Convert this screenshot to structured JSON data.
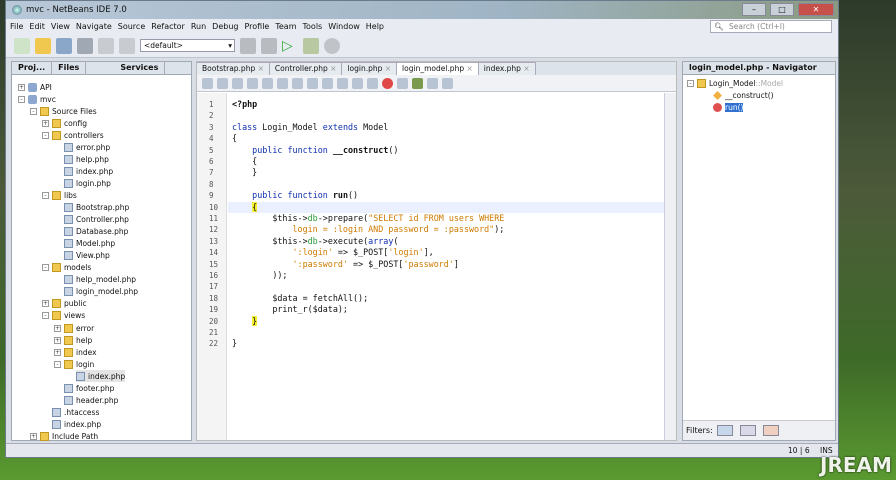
{
  "window": {
    "title": "mvc - NetBeans IDE 7.0"
  },
  "menu": [
    "File",
    "Edit",
    "View",
    "Navigate",
    "Source",
    "Refactor",
    "Run",
    "Debug",
    "Profile",
    "Team",
    "Tools",
    "Window",
    "Help"
  ],
  "search": {
    "placeholder": "Search (Ctrl+I)"
  },
  "toolbar": {
    "config": "<default>"
  },
  "left_tabs": [
    "Proj...",
    "Files",
    "Services"
  ],
  "tree": [
    {
      "label": "API",
      "depth": 0,
      "type": "proj",
      "exp": "+"
    },
    {
      "label": "mvc",
      "depth": 0,
      "type": "proj",
      "exp": "-"
    },
    {
      "label": "Source Files",
      "depth": 1,
      "type": "folder",
      "exp": "-"
    },
    {
      "label": "config",
      "depth": 2,
      "type": "folder",
      "exp": "+"
    },
    {
      "label": "controllers",
      "depth": 2,
      "type": "folder",
      "exp": "-"
    },
    {
      "label": "error.php",
      "depth": 3,
      "type": "file"
    },
    {
      "label": "help.php",
      "depth": 3,
      "type": "file"
    },
    {
      "label": "index.php",
      "depth": 3,
      "type": "file"
    },
    {
      "label": "login.php",
      "depth": 3,
      "type": "file"
    },
    {
      "label": "libs",
      "depth": 2,
      "type": "folder",
      "exp": "-"
    },
    {
      "label": "Bootstrap.php",
      "depth": 3,
      "type": "file"
    },
    {
      "label": "Controller.php",
      "depth": 3,
      "type": "file"
    },
    {
      "label": "Database.php",
      "depth": 3,
      "type": "file"
    },
    {
      "label": "Model.php",
      "depth": 3,
      "type": "file"
    },
    {
      "label": "View.php",
      "depth": 3,
      "type": "file"
    },
    {
      "label": "models",
      "depth": 2,
      "type": "folder",
      "exp": "-"
    },
    {
      "label": "help_model.php",
      "depth": 3,
      "type": "file"
    },
    {
      "label": "login_model.php",
      "depth": 3,
      "type": "file"
    },
    {
      "label": "public",
      "depth": 2,
      "type": "folder",
      "exp": "+"
    },
    {
      "label": "views",
      "depth": 2,
      "type": "folder",
      "exp": "-"
    },
    {
      "label": "error",
      "depth": 3,
      "type": "folder",
      "exp": "+"
    },
    {
      "label": "help",
      "depth": 3,
      "type": "folder",
      "exp": "+"
    },
    {
      "label": "index",
      "depth": 3,
      "type": "folder",
      "exp": "+"
    },
    {
      "label": "login",
      "depth": 3,
      "type": "folder",
      "exp": "-"
    },
    {
      "label": "index.php",
      "depth": 4,
      "type": "file",
      "selected": true
    },
    {
      "label": "footer.php",
      "depth": 3,
      "type": "file"
    },
    {
      "label": "header.php",
      "depth": 3,
      "type": "file"
    },
    {
      "label": ".htaccess",
      "depth": 2,
      "type": "file"
    },
    {
      "label": "index.php",
      "depth": 2,
      "type": "file"
    },
    {
      "label": "Include Path",
      "depth": 1,
      "type": "folder",
      "exp": "+"
    }
  ],
  "editor_tabs": [
    {
      "label": "Bootstrap.php"
    },
    {
      "label": "Controller.php"
    },
    {
      "label": "login.php"
    },
    {
      "label": "login_model.php",
      "active": true
    },
    {
      "label": "index.php"
    }
  ],
  "code": [
    [
      [
        "<?php",
        "fn"
      ]
    ],
    [],
    [
      [
        "class",
        "kw"
      ],
      [
        " Login_Model ",
        ""
      ],
      [
        "extends",
        "kw"
      ],
      [
        " Model",
        ""
      ]
    ],
    [
      [
        "{",
        ""
      ]
    ],
    [
      [
        "    ",
        ""
      ],
      [
        "public",
        "kw"
      ],
      [
        " ",
        ""
      ],
      [
        "function",
        "kw"
      ],
      [
        " ",
        ""
      ],
      [
        "__construct",
        "fn"
      ],
      [
        "()",
        ""
      ]
    ],
    [
      [
        "    {",
        ""
      ]
    ],
    [
      [
        "    }",
        ""
      ]
    ],
    [],
    [
      [
        "    ",
        ""
      ],
      [
        "public",
        "kw"
      ],
      [
        " ",
        ""
      ],
      [
        "function",
        "kw"
      ],
      [
        " ",
        ""
      ],
      [
        "run",
        "fn"
      ],
      [
        "()",
        ""
      ]
    ],
    [
      [
        "    ",
        ""
      ],
      [
        "{",
        "br"
      ]
    ],
    [
      [
        "        $this->",
        ""
      ],
      [
        "db",
        "gr"
      ],
      [
        "->prepare(",
        ""
      ],
      [
        "\"SELECT id FROM users WHERE",
        "st"
      ]
    ],
    [
      [
        "            login = :login AND password = :password\"",
        "st"
      ],
      [
        ");",
        ""
      ]
    ],
    [
      [
        "        $this->",
        ""
      ],
      [
        "db",
        "gr"
      ],
      [
        "->execute(",
        ""
      ],
      [
        "array",
        "kw"
      ],
      [
        "(",
        ""
      ]
    ],
    [
      [
        "            ",
        ""
      ],
      [
        "':login'",
        "st"
      ],
      [
        " => $_POST[",
        ""
      ],
      [
        "'login'",
        "st"
      ],
      [
        "],",
        ""
      ]
    ],
    [
      [
        "            ",
        ""
      ],
      [
        "':password'",
        "st"
      ],
      [
        " => $_POST[",
        ""
      ],
      [
        "'password'",
        "st"
      ],
      [
        "]",
        ""
      ]
    ],
    [
      [
        "        ));",
        ""
      ]
    ],
    [],
    [
      [
        "        $data = fetchAll();",
        ""
      ]
    ],
    [
      [
        "        print_r($data);",
        ""
      ]
    ],
    [
      [
        "    ",
        ""
      ],
      [
        "}",
        "br"
      ]
    ],
    [],
    [
      [
        "}",
        ""
      ]
    ]
  ],
  "highlighted_line": 10,
  "navigator": {
    "title": "login_model.php - Navigator",
    "class": "Login_Model",
    "extends": "::Model",
    "items": [
      "__construct()",
      "run()"
    ],
    "filters_label": "Filters:"
  },
  "status": {
    "position": "10 | 6",
    "mode": "INS"
  },
  "watermark": "JREAM"
}
